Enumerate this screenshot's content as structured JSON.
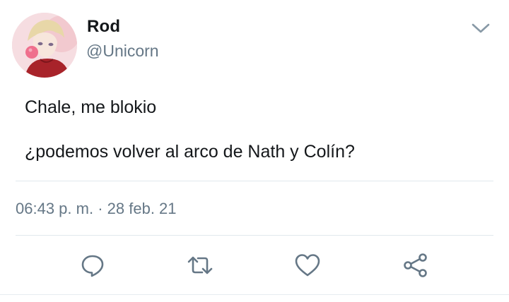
{
  "user": {
    "display_name": "Rod",
    "handle": "@Unicorn"
  },
  "tweet": {
    "lines": [
      "Chale, me blokio",
      "¿podemos volver al arco de Nath y Colín?"
    ],
    "time": "06:43 p. m.",
    "separator": "·",
    "date": "28 feb. 21"
  },
  "icons": {
    "more": "chevron-down-icon",
    "reply": "reply-icon",
    "retweet": "retweet-icon",
    "like": "heart-icon",
    "share": "share-icon"
  },
  "colors": {
    "text": "#14171a",
    "secondary": "#657786",
    "divider": "#e1e8ed",
    "icon": "#657786",
    "avatar_bg": "#f4d7dc"
  }
}
